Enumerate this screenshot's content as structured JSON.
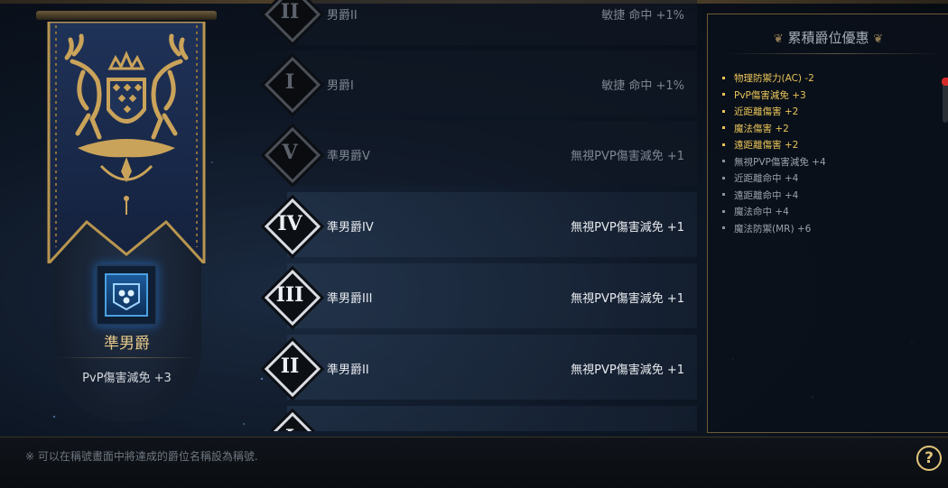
{
  "current_rank": {
    "name": "準男爵",
    "bonus": "PvP傷害減免 +3"
  },
  "ranks": [
    {
      "numeral": "II",
      "name": "男爵II",
      "bonus": "敏捷 命中 +1%",
      "state": "locked"
    },
    {
      "numeral": "I",
      "name": "男爵I",
      "bonus": "敏捷 命中 +1%",
      "state": "locked"
    },
    {
      "numeral": "V",
      "name": "準男爵V",
      "bonus": "無視PVP傷害減免 +1",
      "state": "locked"
    },
    {
      "numeral": "IV",
      "name": "準男爵IV",
      "bonus": "無視PVP傷害減免 +1",
      "state": "achieved"
    },
    {
      "numeral": "III",
      "name": "準男爵III",
      "bonus": "無視PVP傷害減免 +1",
      "state": "achieved"
    },
    {
      "numeral": "II",
      "name": "準男爵II",
      "bonus": "無視PVP傷害減免 +1",
      "state": "achieved"
    },
    {
      "numeral": "I",
      "name": "",
      "bonus": "",
      "state": "achieved"
    }
  ],
  "panel": {
    "title": "累積爵位優惠",
    "bonuses": [
      {
        "text": "物理防禦力(AC) -2",
        "active": true
      },
      {
        "text": "PvP傷害減免 +3",
        "active": true
      },
      {
        "text": "近距離傷害 +2",
        "active": true
      },
      {
        "text": "魔法傷害 +2",
        "active": true
      },
      {
        "text": "遠距離傷害 +2",
        "active": true
      },
      {
        "text": "無視PVP傷害減免 +4",
        "active": false
      },
      {
        "text": "近距離命中 +4",
        "active": false
      },
      {
        "text": "遠距離命中 +4",
        "active": false
      },
      {
        "text": "魔法命中 +4",
        "active": false
      },
      {
        "text": "魔法防禦(MR) +6",
        "active": false
      }
    ]
  },
  "footer": {
    "note": "※ 可以在稱號畫面中將達成的爵位名稱設為稱號.",
    "help_label": "?"
  },
  "colors": {
    "gold": "#e9c458",
    "banner_blue": "#1d2f52",
    "icon_blue": "#4aa0e0"
  }
}
